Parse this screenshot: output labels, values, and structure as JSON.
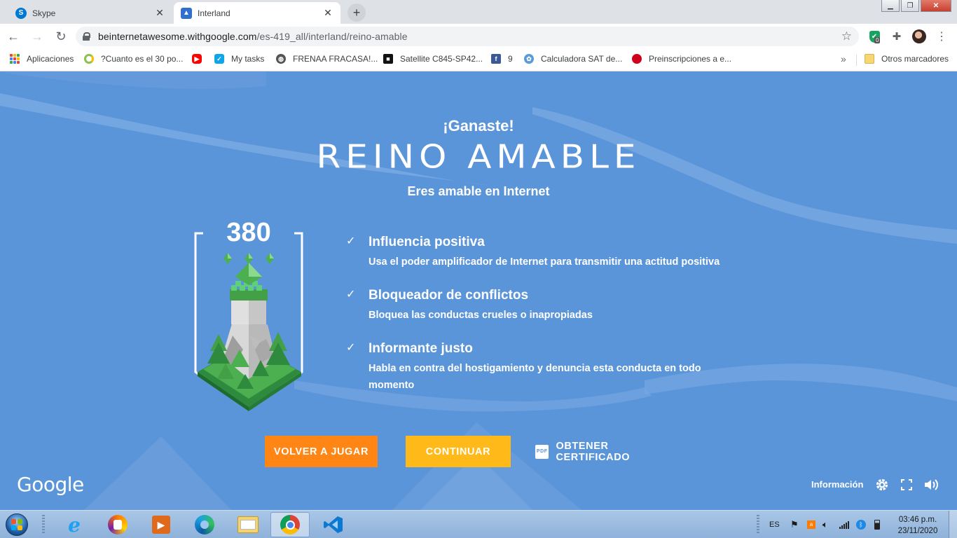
{
  "browser": {
    "tabs": [
      {
        "label": "Skype",
        "active": false,
        "icon": "skype-icon"
      },
      {
        "label": "Interland",
        "active": true,
        "icon": "interland-icon"
      }
    ],
    "url_host": "beinternetawesome.withgoogle.com",
    "url_path": "/es-419_all/interland/reino-amable",
    "extension_badge": "0"
  },
  "bookmarks": [
    {
      "label": "Aplicaciones",
      "icon": "apps-grid-icon"
    },
    {
      "label": "?Cuanto es el 30 po...",
      "icon": "spinner-icon"
    },
    {
      "label": "",
      "icon": "youtube-icon"
    },
    {
      "label": "My tasks",
      "icon": "tasks-icon"
    },
    {
      "label": "FRENAA FRACASA!...",
      "icon": "globe-icon"
    },
    {
      "label": "Satellite C845-SP42...",
      "icon": "toshiba-icon"
    },
    {
      "label": "9",
      "icon": "facebook-icon"
    },
    {
      "label": "Calculadora SAT de...",
      "icon": "flower-icon"
    },
    {
      "label": "Preinscripciones a e...",
      "icon": "red-circle-icon"
    },
    {
      "label": "Otros marcadores",
      "icon": "folder-icon"
    }
  ],
  "game": {
    "win_label": "¡Ganaste!",
    "realm_title": "REINO AMABLE",
    "subtitle": "Eres amable en Internet",
    "score": "380",
    "achievements": [
      {
        "title": "Influencia positiva",
        "description": "Usa el poder amplificador de Internet para transmitir una actitud positiva"
      },
      {
        "title": "Bloqueador de conflictos",
        "description": "Bloquea las conductas crueles o inapropiadas"
      },
      {
        "title": "Informante justo",
        "description": "Habla en contra del hostigamiento y denuncia esta conducta en todo momento"
      }
    ],
    "buttons": {
      "play_again": "VOLVER A JUGAR",
      "continue": "CONTINUAR",
      "certificate": "OBTENER CERTIFICADO"
    },
    "pdf_label": "PDF",
    "brand": "Google",
    "info_link": "Información",
    "colors": {
      "background": "#5b95d9",
      "play_again": "#ff8514",
      "continue": "#ffb918",
      "gem": "#4caf50"
    }
  },
  "taskbar": {
    "language": "ES",
    "time": "03:46 p.m.",
    "date": "23/11/2020",
    "apps": [
      "internet-explorer-icon",
      "avast-secure-browser-icon",
      "media-player-icon",
      "edge-icon",
      "file-explorer-icon",
      "chrome-icon",
      "vscode-icon"
    ]
  }
}
